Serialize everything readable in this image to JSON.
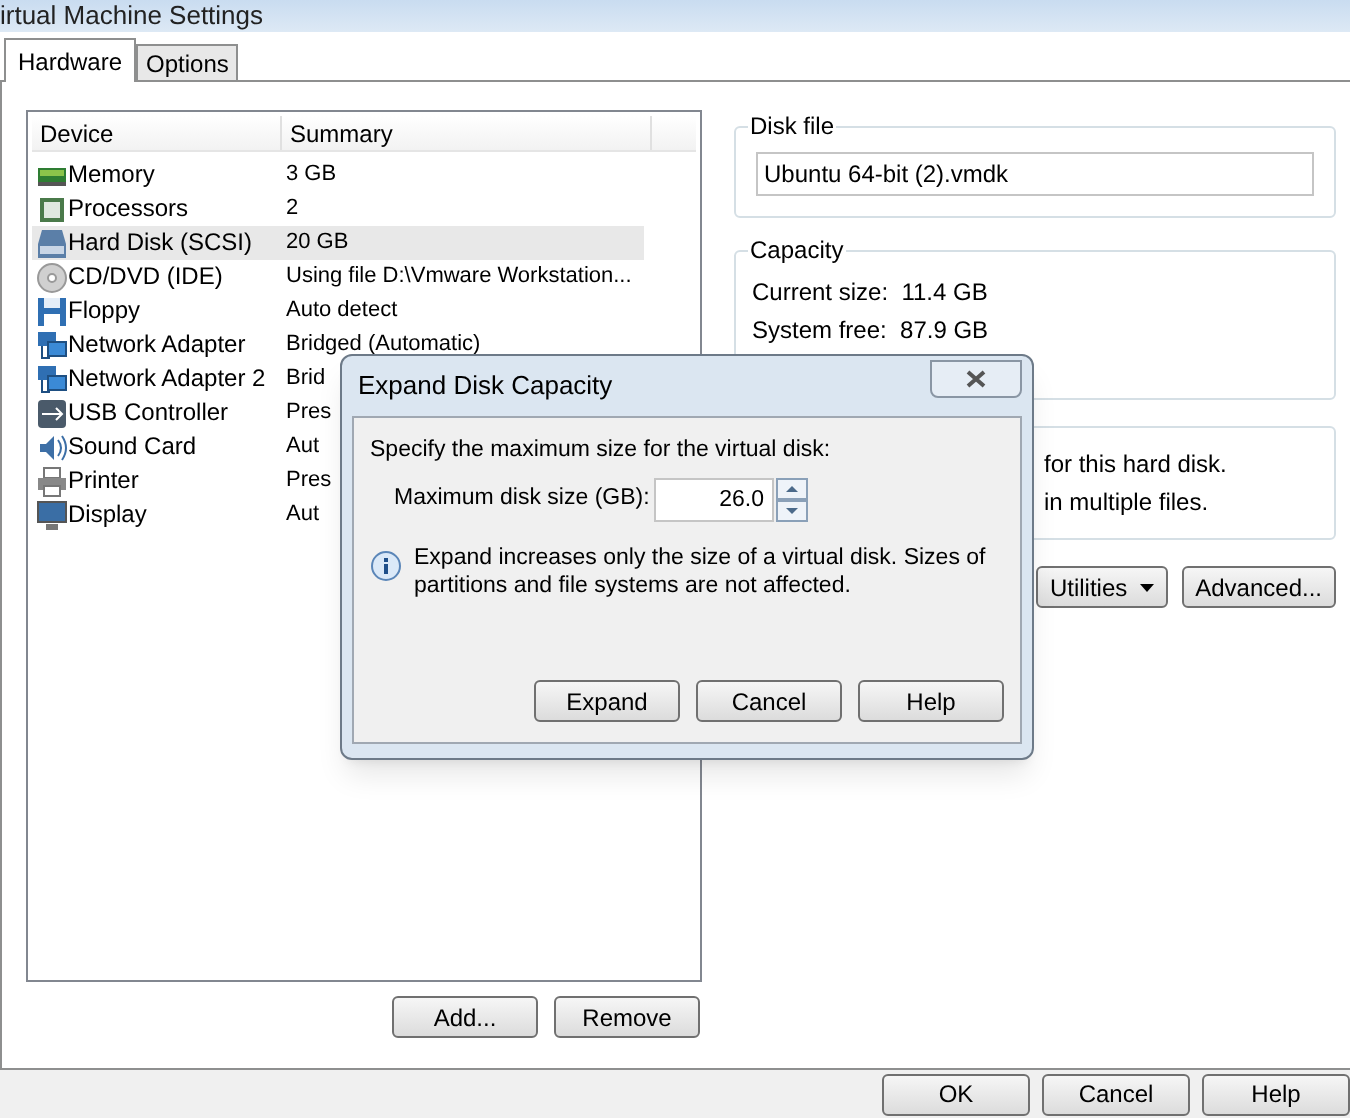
{
  "window": {
    "title": "irtual Machine Settings"
  },
  "tabs": [
    {
      "label": "Hardware",
      "selected": true
    },
    {
      "label": "Options",
      "selected": false
    }
  ],
  "device_list": {
    "columns": [
      "Device",
      "Summary"
    ],
    "rows": [
      {
        "kind": "memory",
        "device": "Memory",
        "summary": "3 GB",
        "selected": false
      },
      {
        "kind": "processor",
        "device": "Processors",
        "summary": "2",
        "selected": false
      },
      {
        "kind": "disk",
        "device": "Hard Disk (SCSI)",
        "summary": "20 GB",
        "selected": true
      },
      {
        "kind": "cd",
        "device": "CD/DVD (IDE)",
        "summary": "Using file D:\\Vmware Workstation...",
        "selected": false
      },
      {
        "kind": "floppy",
        "device": "Floppy",
        "summary": "Auto detect",
        "selected": false
      },
      {
        "kind": "network",
        "device": "Network Adapter",
        "summary": "Bridged (Automatic)",
        "selected": false
      },
      {
        "kind": "network",
        "device": "Network Adapter 2",
        "summary": "Brid",
        "selected": false
      },
      {
        "kind": "usb",
        "device": "USB Controller",
        "summary": "Pres",
        "selected": false
      },
      {
        "kind": "sound",
        "device": "Sound Card",
        "summary": "Aut",
        "selected": false
      },
      {
        "kind": "printer",
        "device": "Printer",
        "summary": "Pres",
        "selected": false
      },
      {
        "kind": "display",
        "device": "Display",
        "summary": "Aut",
        "selected": false
      }
    ]
  },
  "list_buttons": [
    "Add...",
    "Remove"
  ],
  "disk_file": {
    "title": "Disk file",
    "value": "Ubuntu 64-bit (2).vmdk"
  },
  "capacity": {
    "title": "Capacity",
    "lines": [
      "Current size:  11.4 GB",
      "System free:  87.9 GB"
    ]
  },
  "disk_info": {
    "lines": [
      "for this hard disk.",
      "in multiple files."
    ]
  },
  "disk_buttons": [
    {
      "label": "Utilities",
      "kind": "menu"
    },
    {
      "label": "Advanced...",
      "kind": "plain"
    }
  ],
  "dialog": {
    "title": "Expand Disk Capacity",
    "prompt": "Specify the maximum size for the virtual disk:",
    "field_label": "Maximum disk size (GB):",
    "value": "26.0",
    "note": "Expand increases only the size of a virtual disk. Sizes of partitions and file systems are not affected.",
    "buttons": [
      "Expand",
      "Cancel",
      "Help"
    ]
  },
  "buttons": [
    "OK",
    "Cancel",
    "Help"
  ]
}
